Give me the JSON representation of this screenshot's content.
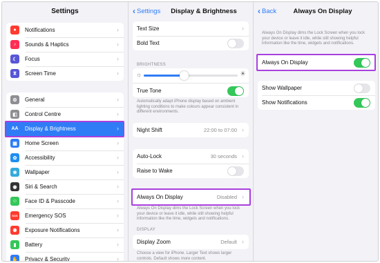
{
  "colors": {
    "accent": "#2f7cf6",
    "toggle_on": "#34c759",
    "highlight": "#a93fde"
  },
  "sidebar": {
    "title": "Settings",
    "groups": [
      [
        {
          "label": "Notifications",
          "icon": "bell-icon",
          "color": "#ff3b30",
          "glyph": "●"
        },
        {
          "label": "Sounds & Haptics",
          "icon": "speaker-icon",
          "color": "#ff2d55",
          "glyph": "♪"
        },
        {
          "label": "Focus",
          "icon": "moon-icon",
          "color": "#5856d6",
          "glyph": "☾"
        },
        {
          "label": "Screen Time",
          "icon": "hourglass-icon",
          "color": "#5856d6",
          "glyph": "⧗"
        }
      ],
      [
        {
          "label": "General",
          "icon": "gear-icon",
          "color": "#8e8e93",
          "glyph": "⚙"
        },
        {
          "label": "Control Centre",
          "icon": "switches-icon",
          "color": "#8e8e93",
          "glyph": "◧"
        },
        {
          "label": "Display & Brightness",
          "icon": "aa-icon",
          "color": "#2f7cf6",
          "glyph": "AA",
          "selected": true
        },
        {
          "label": "Home Screen",
          "icon": "grid-icon",
          "color": "#2f7cf6",
          "glyph": "▦"
        },
        {
          "label": "Accessibility",
          "icon": "accessibility-icon",
          "color": "#1f8ef1",
          "glyph": "✿"
        },
        {
          "label": "Wallpaper",
          "icon": "flower-icon",
          "color": "#34aadc",
          "glyph": "❀"
        },
        {
          "label": "Siri & Search",
          "icon": "siri-icon",
          "color": "#333333",
          "glyph": "◉"
        },
        {
          "label": "Face ID & Passcode",
          "icon": "face-id-icon",
          "color": "#34c759",
          "glyph": "☺"
        },
        {
          "label": "Emergency SOS",
          "icon": "sos-icon",
          "color": "#ff3b30",
          "glyph": "SOS"
        },
        {
          "label": "Exposure Notifications",
          "icon": "exposure-icon",
          "color": "#ff3b30",
          "glyph": "✺"
        },
        {
          "label": "Battery",
          "icon": "battery-icon",
          "color": "#34c759",
          "glyph": "▮"
        },
        {
          "label": "Privacy & Security",
          "icon": "hand-icon",
          "color": "#2f7cf6",
          "glyph": "✋"
        }
      ]
    ]
  },
  "display": {
    "back_label": "Settings",
    "title": "Display & Brightness",
    "text_size": "Text Size",
    "bold_text": "Bold Text",
    "brightness_header": "BRIGHTNESS",
    "brightness_level": 0.43,
    "true_tone": "True Tone",
    "true_tone_note": "Automatically adapt iPhone display based on ambient lighting conditions to make colours appear consistent in different environments.",
    "night_shift": "Night Shift",
    "night_shift_value": "22:00 to 07:00",
    "auto_lock": "Auto-Lock",
    "auto_lock_value": "30 seconds",
    "raise_to_wake": "Raise to Wake",
    "always_on": "Always On Display",
    "always_on_value": "Disabled",
    "always_on_note": "Always On Display dims the Lock Screen when you lock your device or leave it idle, while still showing helpful information like the time, widgets and notifications.",
    "display_header": "DISPLAY",
    "display_zoom": "Display Zoom",
    "display_zoom_value": "Default",
    "display_zoom_note": "Choose a view for iPhone. Larger Text shows larger controls. Default shows more content."
  },
  "aod": {
    "back_label": "Back",
    "title": "Always On Display",
    "intro": "Always On Display dims the Lock Screen when you lock your device or leave it idle, while still showing helpful information like the time, widgets and notifications.",
    "toggle_label": "Always On Display",
    "show_wallpaper": "Show Wallpaper",
    "show_notifications": "Show Notifications"
  }
}
